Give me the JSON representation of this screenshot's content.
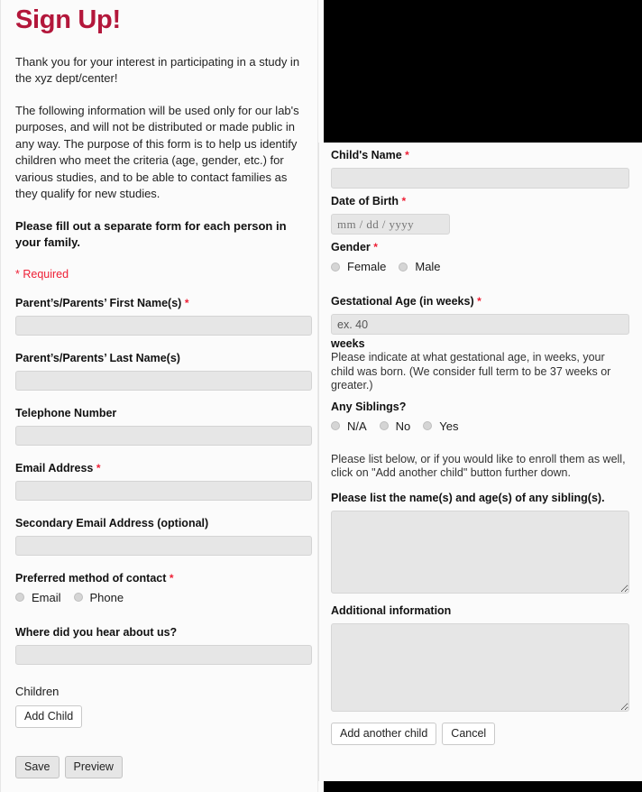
{
  "left": {
    "title": "Sign Up!",
    "intro_1": "Thank you for your interest in participating in a study in the xyz dept/center!",
    "intro_2": "The following information will be used only for our lab's purposes, and will not be distributed or made public in any way. The purpose of this form is to help us identify children who meet the criteria (age, gender, etc.) for various studies, and to be able to contact families as they qualify for new studies.",
    "bold_note": "Please fill out a separate form for each person in your family.",
    "required_note": "* Required",
    "fields": {
      "first_names_label": "Parent’s/Parents’ First Name(s)",
      "first_names_value": "",
      "last_names_label": "Parent’s/Parents’ Last Name(s)",
      "last_names_value": "",
      "telephone_label": "Telephone Number",
      "telephone_value": "",
      "email_label": "Email Address",
      "email_value": "",
      "secondary_email_label": "Secondary Email Address (optional)",
      "secondary_email_value": "",
      "contact_method_label": "Preferred method of contact",
      "contact_options": [
        "Email",
        "Phone"
      ],
      "hear_about_label": "Where did you hear about us?",
      "hear_about_value": "",
      "children_label": "Children",
      "add_child_button": "Add Child",
      "save_button": "Save",
      "preview_button": "Preview"
    },
    "required_marker": "*"
  },
  "right": {
    "fields": {
      "child_name_label": "Child's Name",
      "child_name_value": "",
      "dob_label": "Date of Birth",
      "dob_placeholder": "mm / dd / yyyy",
      "dob_value": "",
      "gender_label": "Gender",
      "gender_options": [
        "Female",
        "Male"
      ],
      "gestational_age_label": "Gestational Age (in weeks)",
      "gestational_age_placeholder": "ex. 40",
      "gestational_age_value": "",
      "gestational_unit": "weeks",
      "gestational_helper": "Please indicate at what gestational age, in weeks, your child was born. (We consider full term to be 37 weeks or greater.)",
      "siblings_label": "Any Siblings?",
      "siblings_options": [
        "N/A",
        "No",
        "Yes"
      ],
      "siblings_note": "Please list below, or if you would like to enroll them as well, click on \"Add another child\" button further down.",
      "siblings_list_label": "Please list the name(s) and age(s) of any sibling(s).",
      "siblings_list_value": "",
      "additional_info_label": "Additional information",
      "additional_info_value": "",
      "add_another_child_button": "Add another child",
      "cancel_button": "Cancel"
    },
    "required_marker": "*"
  },
  "colors": {
    "title": "#b3173b",
    "required": "#ee1f35",
    "input_bg": "#e6e6e6",
    "panel_bg": "#fbfbfb"
  }
}
